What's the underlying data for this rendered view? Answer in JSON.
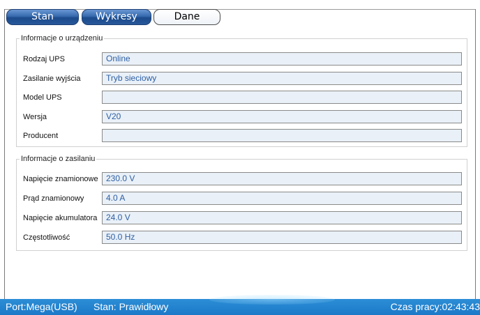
{
  "tabs": [
    {
      "label": "Stan",
      "active": false
    },
    {
      "label": "Wykresy",
      "active": false
    },
    {
      "label": "Dane",
      "active": true
    }
  ],
  "device_info": {
    "title": "Informacje o urządzeniu",
    "rows": [
      {
        "label": "Rodzaj UPS",
        "value": "Online"
      },
      {
        "label": "Zasilanie wyjścia",
        "value": "Tryb sieciowy"
      },
      {
        "label": "Model UPS",
        "value": ""
      },
      {
        "label": "Wersja",
        "value": "V20"
      },
      {
        "label": "Producent",
        "value": ""
      }
    ]
  },
  "power_info": {
    "title": "Informacje o zasilaniu",
    "rows": [
      {
        "label": "Napięcie znamionowe",
        "value": "230.0 V"
      },
      {
        "label": "Prąd znamionowy",
        "value": "4.0 A"
      },
      {
        "label": "Napięcie akumulatora",
        "value": "24.0 V"
      },
      {
        "label": "Częstotliwość",
        "value": "50.0 Hz"
      }
    ]
  },
  "status_bar": {
    "port": "Port:Mega(USB)",
    "state": "Stan: Prawidłowy",
    "uptime": "Czas pracy:02:43:43"
  },
  "colors": {
    "tab_inactive": "#3569ad",
    "field_background": "#e9f0f7",
    "field_text": "#2e5fa4",
    "status_bar": "#1c79c8"
  }
}
